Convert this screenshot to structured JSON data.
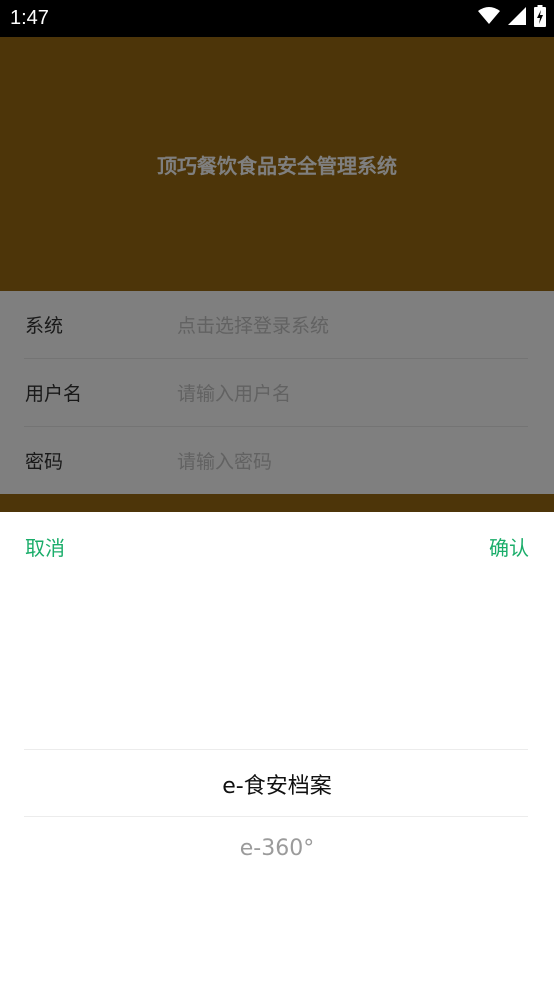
{
  "status_bar": {
    "time": "1:47",
    "icons": [
      "wifi-icon",
      "cellular-signal-icon",
      "battery-charging-icon"
    ]
  },
  "app": {
    "title": "顶巧餐饮食品安全管理系统",
    "form": {
      "rows": [
        {
          "label": "系统",
          "placeholder": "点击选择登录系统"
        },
        {
          "label": "用户名",
          "placeholder": "请输入用户名"
        },
        {
          "label": "密码",
          "placeholder": "请输入密码"
        }
      ]
    }
  },
  "picker": {
    "cancel_label": "取消",
    "confirm_label": "确认",
    "options": [
      "e-食安档案",
      "e-360°"
    ],
    "selected_index": 0
  },
  "colors": {
    "header_brown": "#9a6a12",
    "accent_green": "#1aad6a",
    "status_bar_black": "#000000"
  }
}
